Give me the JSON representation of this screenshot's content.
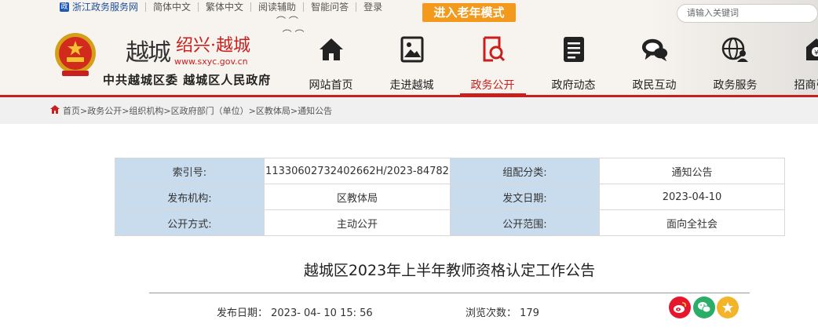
{
  "topbar": {
    "items": [
      "浙江政务服务网",
      "简体中文",
      "繁体中文",
      "阅读辅助",
      "智能问答",
      "登录"
    ],
    "elder_mode": "进入老年模式",
    "search_placeholder": "请输入关键词"
  },
  "brand": {
    "calligraphy": "越城",
    "site_name": "绍兴·越城",
    "url": "www.sxyc.gov.cn",
    "org": "中共越城区委 越城区人民政府"
  },
  "nav": [
    {
      "label": "网站首页",
      "icon": "home-icon"
    },
    {
      "label": "走进越城",
      "icon": "picture-icon"
    },
    {
      "label": "政务公开",
      "icon": "document-search-icon",
      "active": true
    },
    {
      "label": "政府动态",
      "icon": "news-icon"
    },
    {
      "label": "政民互动",
      "icon": "chat-icon"
    },
    {
      "label": "政务服务",
      "icon": "globe-user-icon"
    },
    {
      "label": "招商引资",
      "icon": "investment-icon"
    }
  ],
  "breadcrumb": "首页>政务公开>组织机构>区政府部门（单位）>区教体局>通知公告",
  "meta": {
    "rows": [
      [
        {
          "k": "索引号:",
          "v": "11330602732402662H/2023-84782"
        },
        {
          "k": "组配分类:",
          "v": "通知公告"
        }
      ],
      [
        {
          "k": "发布机构:",
          "v": "区教体局"
        },
        {
          "k": "发文日期:",
          "v": "2023-04-10"
        }
      ],
      [
        {
          "k": "公开方式:",
          "v": "主动公开"
        },
        {
          "k": "公开范围:",
          "v": "面向全社会"
        }
      ]
    ]
  },
  "article": {
    "title": "越城区2023年上半年教师资格认定工作公告",
    "pub_date": "发布日期：  2023- 04- 10 15: 56",
    "views": "浏览次数：  179"
  },
  "share": [
    {
      "icon": "weibo-icon",
      "color": "#e6162d"
    },
    {
      "icon": "wechat-icon",
      "color": "#2aae67"
    },
    {
      "icon": "favorite-icon",
      "color": "#f3b42a"
    }
  ],
  "colors": {
    "brand_red": "#c8201e",
    "elder_orange": "#f39a1c",
    "meta_key_bg": "#c9dcee"
  }
}
